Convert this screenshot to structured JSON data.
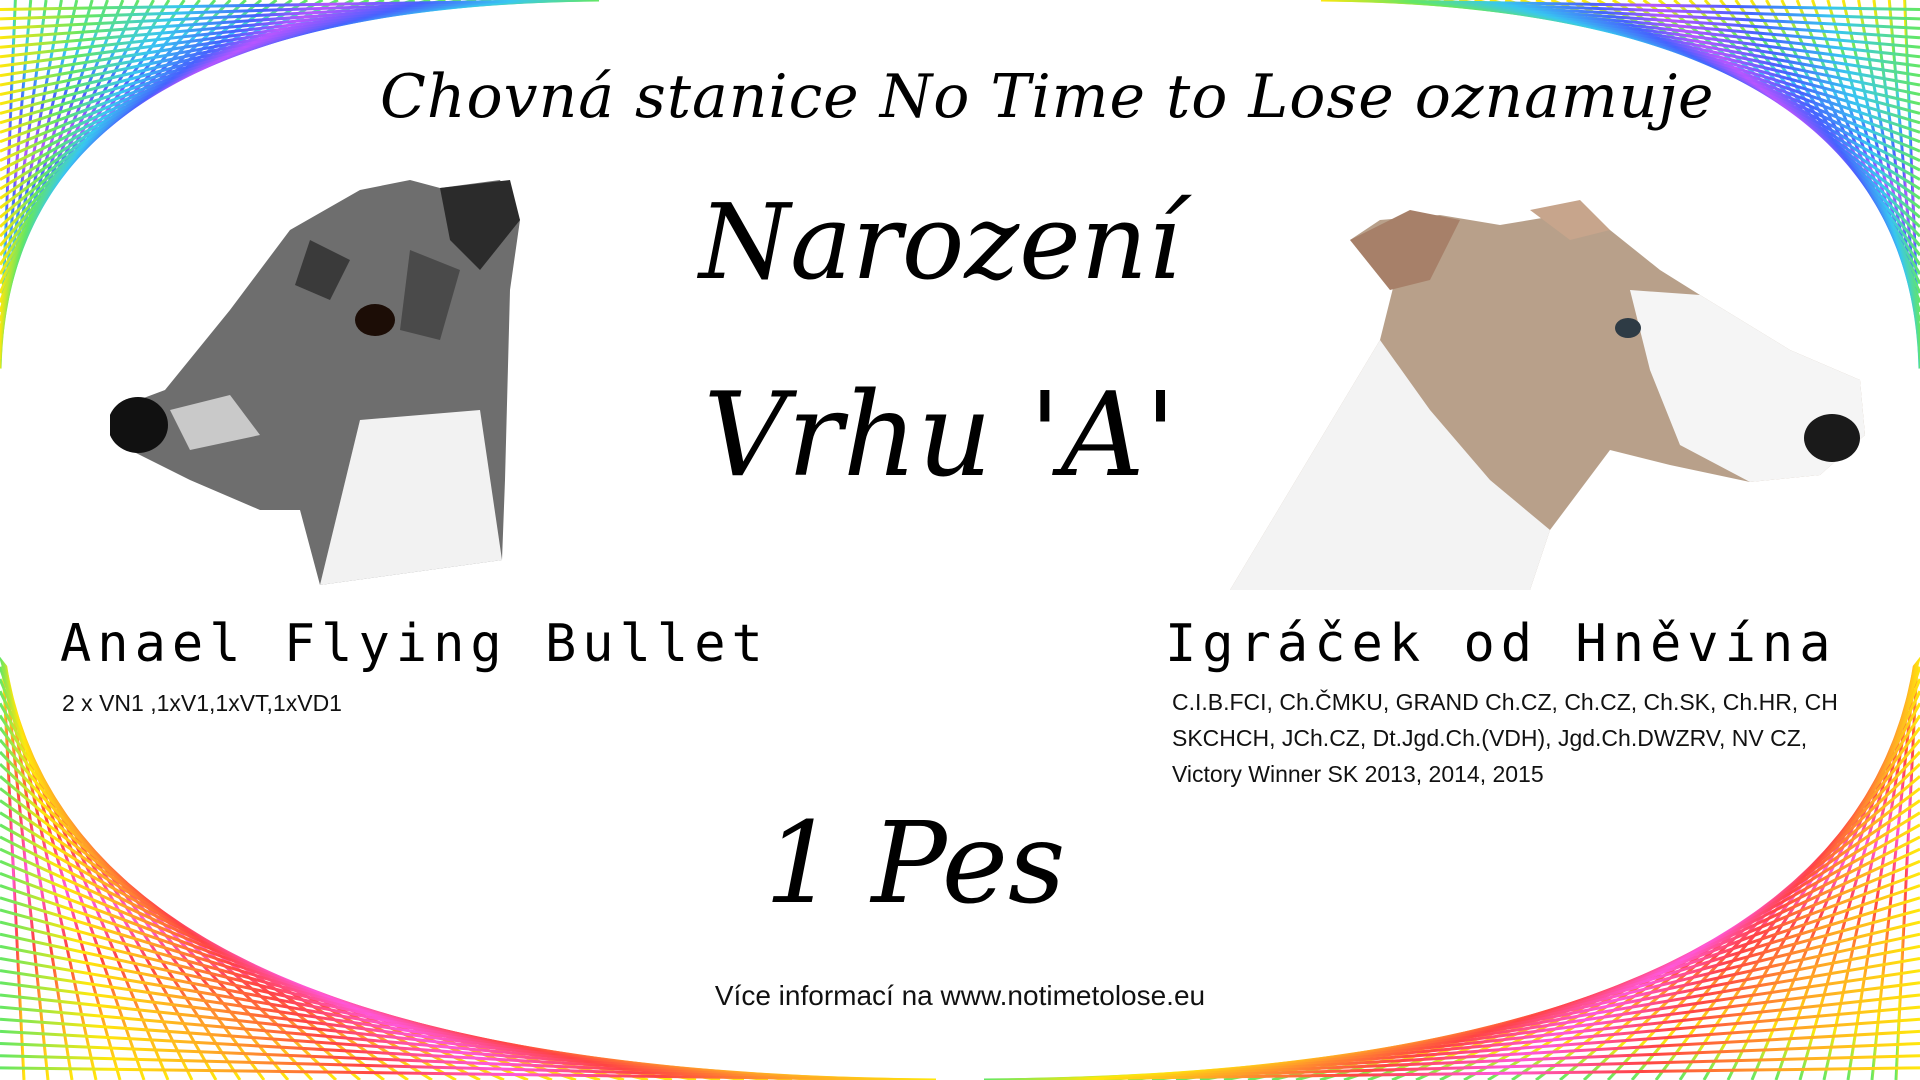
{
  "poster": {
    "announcement": "Chovná stanice No Time to Lose oznamuje",
    "headline_line1": "Narození",
    "headline_line2": "Vrhu 'A'",
    "puppy_count": "1 Pes",
    "footer": "Více informací na www.notimetolose.eu"
  },
  "sire": {
    "name": "Anael Flying Bullet",
    "titles": "2 x VN1 ,1xV1,1xVT,1xVD1",
    "photo_icon": "brindle-whippet-head"
  },
  "dam": {
    "name": "Igráček od Hněvína",
    "titles_line1": "C.I.B.FCI, Ch.ČMKU, GRAND Ch.CZ, Ch.CZ, Ch.SK, Ch.HR, CH",
    "titles_line2": "SKCHCH, JCh.CZ, Dt.Jgd.Ch.(VDH), Jgd.Ch.DWZRV, NV CZ,",
    "titles_line3": "Victory Winner SK 2013, 2014, 2015",
    "photo_icon": "fawn-white-whippet-head"
  },
  "colors": {
    "background": "#ffffff",
    "rainbow": [
      "#ff3b3b",
      "#ff9f1c",
      "#ffe600",
      "#5ce65c",
      "#2ec4f0",
      "#3d5afe",
      "#b44dff",
      "#ff4fd8"
    ]
  }
}
